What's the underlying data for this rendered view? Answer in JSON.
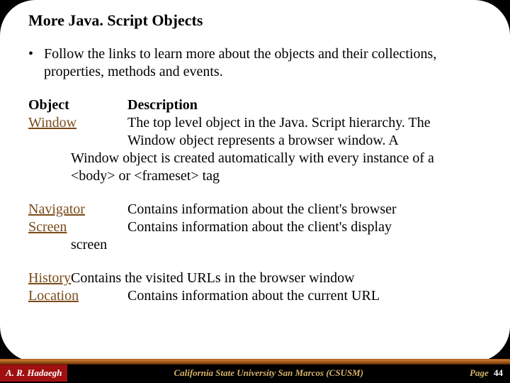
{
  "title": "More Java. Script Objects",
  "bullet": {
    "marker": "•",
    "text": "Follow the links to learn more about the objects and their collections, properties, methods and events."
  },
  "headers": {
    "object": "Object",
    "description": "Description"
  },
  "group1": {
    "obj": "Window",
    "desc_start": "The top level object in the Java. Script hierarchy. The Window object represents a browser window. A",
    "desc_wrap": "Window object is created automatically with every instance of a <body> or <frameset> tag"
  },
  "group2a": {
    "obj": "Navigator",
    "desc": "Contains information about the client's browser"
  },
  "group2b": {
    "obj": "Screen",
    "desc": "Contains information about the client's display",
    "wrap": "screen"
  },
  "group3a": {
    "obj": "History",
    "desc": "Contains the visited URLs in the browser window"
  },
  "group3b": {
    "obj": "Location",
    "desc": "Contains information about the current URL"
  },
  "footer": {
    "author": "A. R. Hadaegh",
    "center": "California State University San Marcos (CSUSM)",
    "page_label": "Page",
    "page_number": "44"
  },
  "chart_data": {
    "type": "table",
    "title": "More Java. Script Objects",
    "columns": [
      "Object",
      "Description"
    ],
    "rows": [
      [
        "Window",
        "The top level object in the Java. Script hierarchy. The Window object represents a browser window. A Window object is created automatically with every instance of a <body> or <frameset> tag"
      ],
      [
        "Navigator",
        "Contains information about the client's browser"
      ],
      [
        "Screen",
        "Contains information about the client's display screen"
      ],
      [
        "History",
        "Contains the visited URLs in the browser window"
      ],
      [
        "Location",
        "Contains information about the current URL"
      ]
    ]
  }
}
